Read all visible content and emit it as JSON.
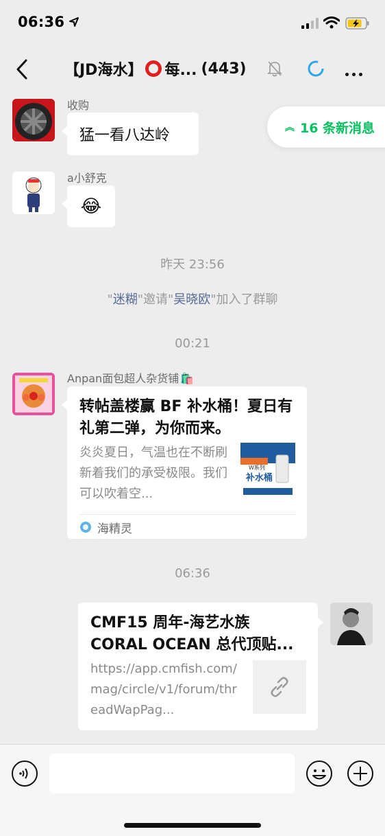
{
  "status": {
    "time": "06:36"
  },
  "nav": {
    "title_prefix": "【JD海水】",
    "title_suffix": "每...",
    "member_count": "(443)"
  },
  "new_messages": {
    "label": "16 条新消息"
  },
  "messages": [
    {
      "sender": "收购",
      "text": "猛一看八达岭"
    },
    {
      "sender": "a小舒克",
      "text": "😂"
    }
  ],
  "timestamps": [
    "昨天 23:56",
    "00:21",
    "06:36"
  ],
  "system": {
    "q1": "\"",
    "inviter": "迷糊",
    "mid": "\"邀请\"",
    "invitee": "吴晓欧",
    "tail": "\"加入了群聊"
  },
  "card1": {
    "sender": "Anpan面包超人杂货铺",
    "sender_emoji": "🛍️",
    "title": "转帖盖楼赢 BF 补水桶！夏日有礼第二弹，为你而来。",
    "desc": "炎炎夏日，气温也在不断刷新着我们的承受极限。我们可以吹着空...",
    "thumb_text": "补水桶",
    "thumb_small": "W系列",
    "source": "海精灵"
  },
  "card2": {
    "title": "CMF15 周年-海艺水族 CORAL OCEAN 总代顶贴...",
    "desc": "https://app.cmfish.com/mag/circle/v1/forum/threadWapPag..."
  },
  "colors": {
    "accent_green": "#07c160",
    "link_blue": "#576b95",
    "spinner_blue": "#2ea6e6"
  }
}
